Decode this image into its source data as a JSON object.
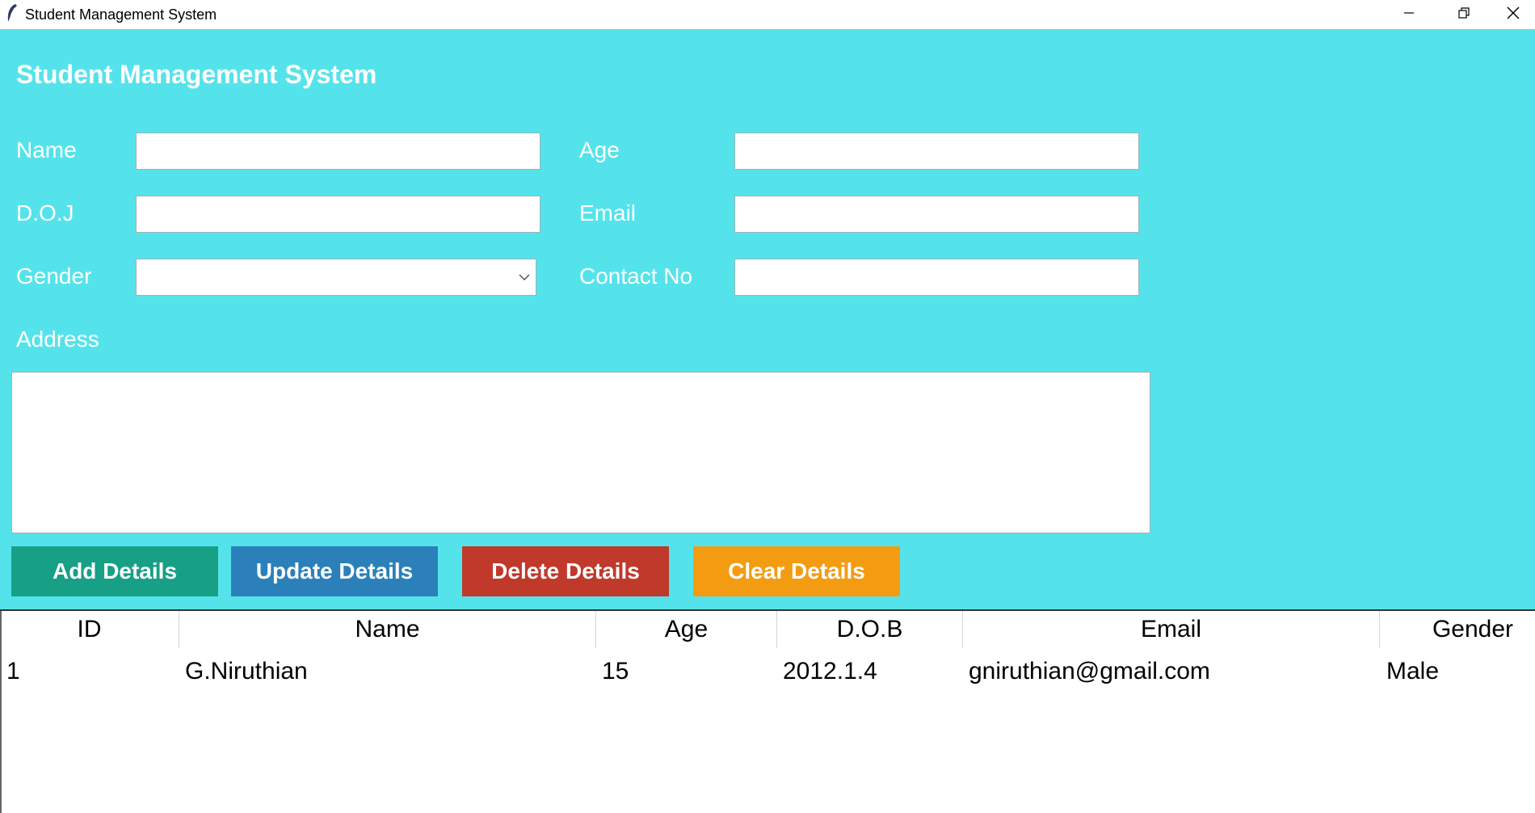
{
  "window": {
    "title": "Student Management System"
  },
  "heading": "Student Management System",
  "labels": {
    "name": "Name",
    "age": "Age",
    "doj": "D.O.J",
    "email": "Email",
    "gender": "Gender",
    "contact": "Contact No",
    "address": "Address"
  },
  "fields": {
    "name": "",
    "age": "",
    "doj": "",
    "email": "",
    "gender": "",
    "contact": "",
    "address": ""
  },
  "buttons": {
    "add": "Add Details",
    "update": "Update Details",
    "delete": "Delete Details",
    "clear": "Clear Details"
  },
  "colors": {
    "background": "#55e3eb",
    "add": "#17a086",
    "update": "#2b80b9",
    "delete": "#c0392b",
    "clear": "#f39c12"
  },
  "table": {
    "columns": [
      "ID",
      "Name",
      "Age",
      "D.O.B",
      "Email",
      "Gender"
    ],
    "rows": [
      [
        "1",
        "G.Niruthian",
        "15",
        "2012.1.4",
        "gniruthian@gmail.com",
        "Male"
      ]
    ]
  }
}
